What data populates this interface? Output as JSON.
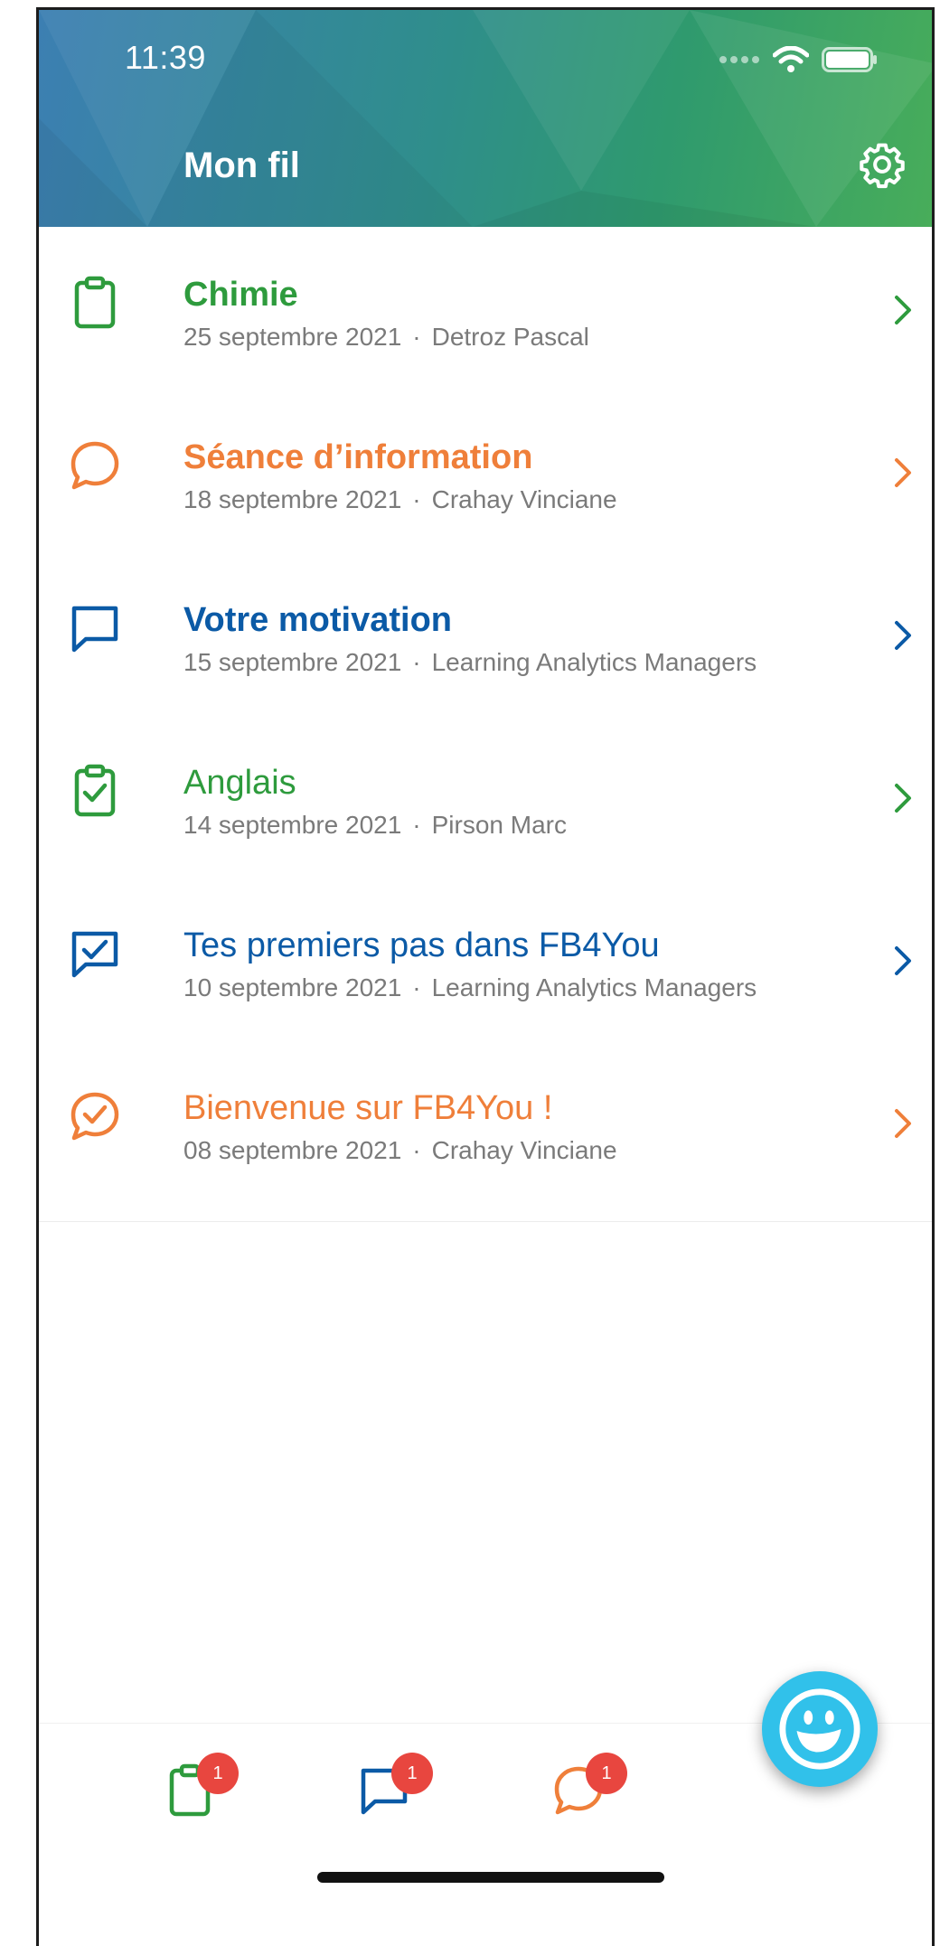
{
  "status_bar": {
    "time": "11:39"
  },
  "header": {
    "title": "Mon fil"
  },
  "colors": {
    "green": "#2e9b3d",
    "orange": "#ef7f3a",
    "blue": "#0b5aa6",
    "meta_gray": "#7a7a7a",
    "badge_red": "#e8463f",
    "fab_cyan": "#31c1ea"
  },
  "feed": {
    "items": [
      {
        "icon": "clipboard-icon",
        "title": "Chimie",
        "date": "25 septembre 2021",
        "separator": "·",
        "author": "Detroz Pascal",
        "color": "#2e9b3d",
        "bold": true
      },
      {
        "icon": "speech-bubble-icon",
        "title": "Séance d’information",
        "date": "18 septembre 2021",
        "separator": "·",
        "author": "Crahay Vinciane",
        "color": "#ef7f3a",
        "bold": true
      },
      {
        "icon": "chat-square-icon",
        "title": "Votre motivation",
        "date": "15 septembre 2021",
        "separator": "·",
        "author": "Learning Analytics Managers",
        "color": "#0b5aa6",
        "bold": true
      },
      {
        "icon": "clipboard-check-icon",
        "title": "Anglais",
        "date": "14 septembre 2021",
        "separator": "·",
        "author": "Pirson Marc",
        "color": "#2e9b3d",
        "bold": false
      },
      {
        "icon": "chat-square-check-icon",
        "title": "Tes premiers pas dans FB4You",
        "date": "10 septembre 2021",
        "separator": "·",
        "author": "Learning Analytics Managers",
        "color": "#0b5aa6",
        "bold": false
      },
      {
        "icon": "speech-bubble-check-icon",
        "title": "Bienvenue sur FB4You !",
        "date": "08 septembre 2021",
        "separator": "·",
        "author": "Crahay Vinciane",
        "color": "#ef7f3a",
        "bold": false
      }
    ]
  },
  "tabbar": {
    "tabs": [
      {
        "icon": "clipboard-icon",
        "badge": "1",
        "color": "#2e9b3d"
      },
      {
        "icon": "chat-square-icon",
        "badge": "1",
        "color": "#0b5aa6"
      },
      {
        "icon": "speech-bubble-icon",
        "badge": "1",
        "color": "#ef7f3a"
      }
    ]
  },
  "fab": {
    "icon": "smiley-icon"
  }
}
